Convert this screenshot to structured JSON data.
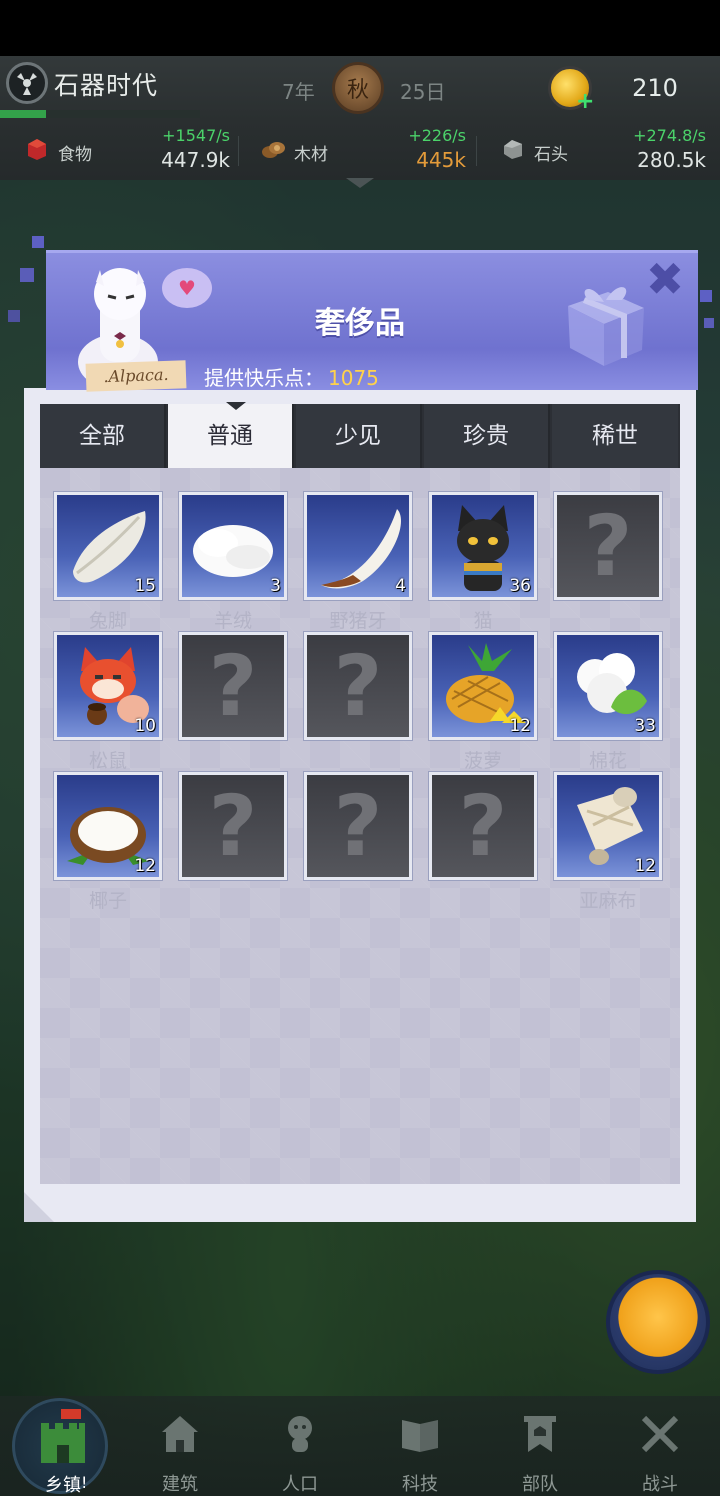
{
  "header": {
    "game_title": "石器时代",
    "year": "7年",
    "season": "秋",
    "day": "25日",
    "coins": "210",
    "progress": 0.23
  },
  "resources": [
    {
      "label": "食物",
      "rate": "+1547/s",
      "amount": "447.9k",
      "icon": "food-icon"
    },
    {
      "label": "木材",
      "rate": "+226/s",
      "amount": "445k",
      "icon": "wood-icon"
    },
    {
      "label": "石头",
      "rate": "+274.8/s",
      "amount": "280.5k",
      "icon": "stone-icon"
    }
  ],
  "dialog": {
    "title": "奢侈品",
    "points_label": "提供快乐点：",
    "points_value": "1075",
    "mascot_sign": ".Alpaca."
  },
  "tabs": [
    {
      "label": "全部",
      "active": false
    },
    {
      "label": "普通",
      "active": true
    },
    {
      "label": "少见",
      "active": false
    },
    {
      "label": "珍贵",
      "active": false
    },
    {
      "label": "稀世",
      "active": false
    }
  ],
  "items": [
    {
      "name": "兔脚",
      "count": "15",
      "icon": "rabbit-foot-icon",
      "locked": false
    },
    {
      "name": "羊绒",
      "count": "3",
      "icon": "cashmere-icon",
      "locked": false
    },
    {
      "name": "野猪牙",
      "count": "4",
      "icon": "boar-tusk-icon",
      "locked": false
    },
    {
      "name": "猫",
      "count": "36",
      "icon": "cat-icon",
      "locked": false
    },
    {
      "name": "",
      "count": "",
      "icon": "unknown-icon",
      "locked": true
    },
    {
      "name": "松鼠",
      "count": "10",
      "icon": "squirrel-icon",
      "locked": false
    },
    {
      "name": "",
      "count": "",
      "icon": "unknown-icon",
      "locked": true
    },
    {
      "name": "",
      "count": "",
      "icon": "unknown-icon",
      "locked": true
    },
    {
      "name": "菠萝",
      "count": "12",
      "icon": "pineapple-icon",
      "locked": false
    },
    {
      "name": "棉花",
      "count": "33",
      "icon": "cotton-icon",
      "locked": false
    },
    {
      "name": "椰子",
      "count": "12",
      "icon": "coconut-icon",
      "locked": false
    },
    {
      "name": "",
      "count": "",
      "icon": "unknown-icon",
      "locked": true
    },
    {
      "name": "",
      "count": "",
      "icon": "unknown-icon",
      "locked": true
    },
    {
      "name": "",
      "count": "",
      "icon": "unknown-icon",
      "locked": true
    },
    {
      "name": "亚麻布",
      "count": "12",
      "icon": "linen-icon",
      "locked": false
    }
  ],
  "locked_mark": "?",
  "nav": [
    {
      "label": "乡镇",
      "icon": "town-icon"
    },
    {
      "label": "建筑",
      "icon": "building-icon"
    },
    {
      "label": "人口",
      "icon": "population-icon"
    },
    {
      "label": "科技",
      "icon": "tech-book-icon"
    },
    {
      "label": "部队",
      "icon": "army-banner-icon"
    },
    {
      "label": "战斗",
      "icon": "crossed-swords-icon"
    }
  ],
  "nav_home_badge": "!"
}
